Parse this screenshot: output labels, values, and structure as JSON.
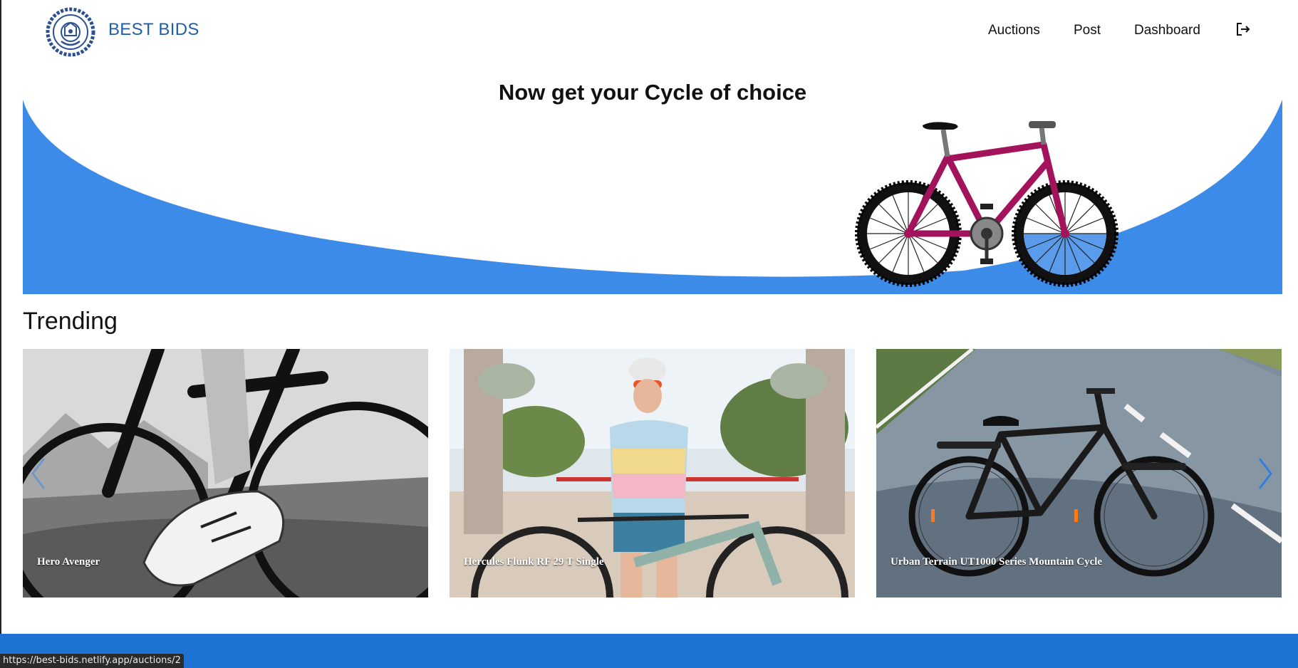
{
  "header": {
    "brand": "BEST BIDS",
    "nav": {
      "auctions": "Auctions",
      "post": "Post",
      "dashboard": "Dashboard"
    },
    "logout_icon": "logout-icon"
  },
  "hero": {
    "title": "Now get your Cycle of choice",
    "accent_color": "#3d8be8",
    "bike_color": "#a3135c"
  },
  "trending": {
    "title": "Trending",
    "items": [
      {
        "caption": "Hero Avenger"
      },
      {
        "caption": "Hercules Flunk RF 29 T Single"
      },
      {
        "caption": "Urban Terrain UT1000 Series Mountain Cycle"
      }
    ]
  },
  "footer": {
    "color": "#1e73d2"
  },
  "status_bar": {
    "url": "https://best-bids.netlify.app/auctions/2"
  }
}
